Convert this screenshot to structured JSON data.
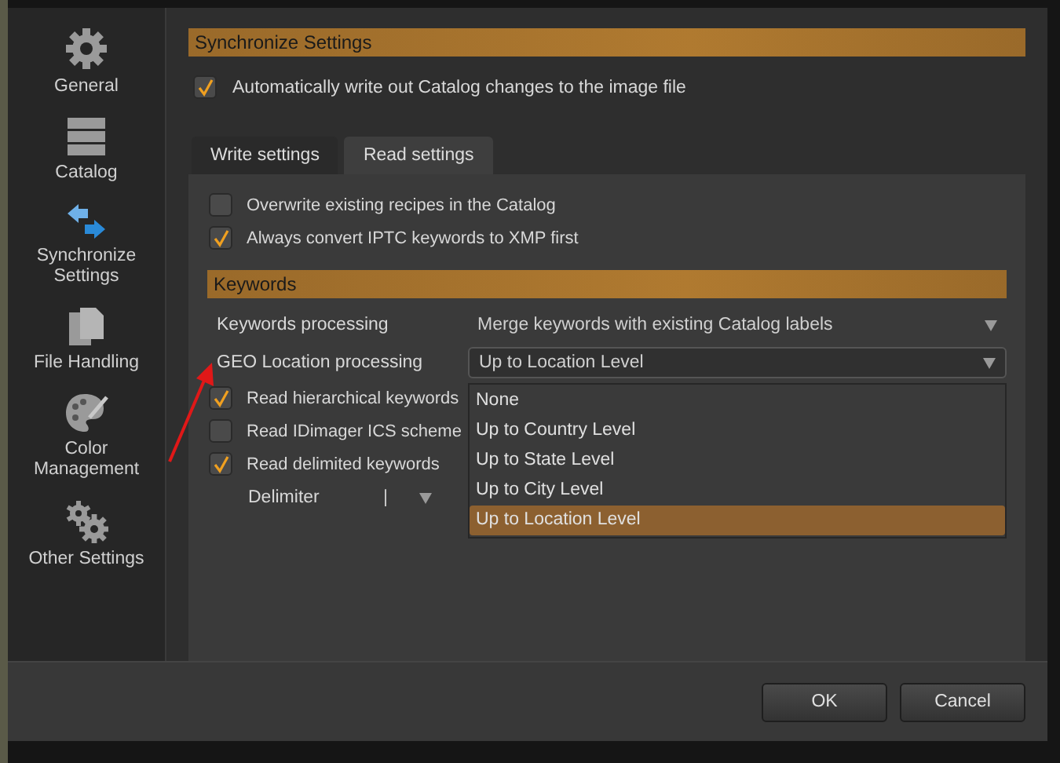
{
  "sidebar": {
    "items": [
      {
        "kind": "gear",
        "label": "General"
      },
      {
        "kind": "stack",
        "label": "Catalog"
      },
      {
        "kind": "sync",
        "label": "Synchronize Settings"
      },
      {
        "kind": "files",
        "label": "File Handling"
      },
      {
        "kind": "palette",
        "label": "Color Management"
      },
      {
        "kind": "gears",
        "label": "Other Settings"
      }
    ]
  },
  "header": "Synchronize Settings",
  "auto_write": {
    "label": "Automatically write out Catalog changes to the image file",
    "checked": true
  },
  "tabs": [
    {
      "label": "Write settings",
      "selected": false
    },
    {
      "label": "Read settings",
      "selected": true
    }
  ],
  "read_options": [
    {
      "label": "Overwrite existing recipes in the Catalog",
      "checked": false
    },
    {
      "label": "Always convert IPTC keywords to XMP first",
      "checked": true
    }
  ],
  "keywords": {
    "title": "Keywords",
    "processing": {
      "label": "Keywords processing",
      "value": "Merge keywords with existing Catalog labels"
    },
    "geo": {
      "label": "GEO Location processing",
      "value": "Up to Location Level",
      "expanded": true,
      "options": [
        {
          "label": "None",
          "selected": false
        },
        {
          "label": "Up to Country Level",
          "selected": false
        },
        {
          "label": "Up to State Level",
          "selected": false
        },
        {
          "label": "Up to City Level",
          "selected": false
        },
        {
          "label": "Up to Location Level",
          "selected": true
        }
      ]
    },
    "options": [
      {
        "label": "Read hierarchical keywords",
        "checked": true
      },
      {
        "label": "Read IDimager ICS scheme",
        "checked": false
      },
      {
        "label": "Read delimited keywords",
        "checked": true
      }
    ],
    "delimiter": {
      "label": "Delimiter",
      "value": "|"
    }
  },
  "buttons": [
    "OK",
    "Cancel"
  ]
}
